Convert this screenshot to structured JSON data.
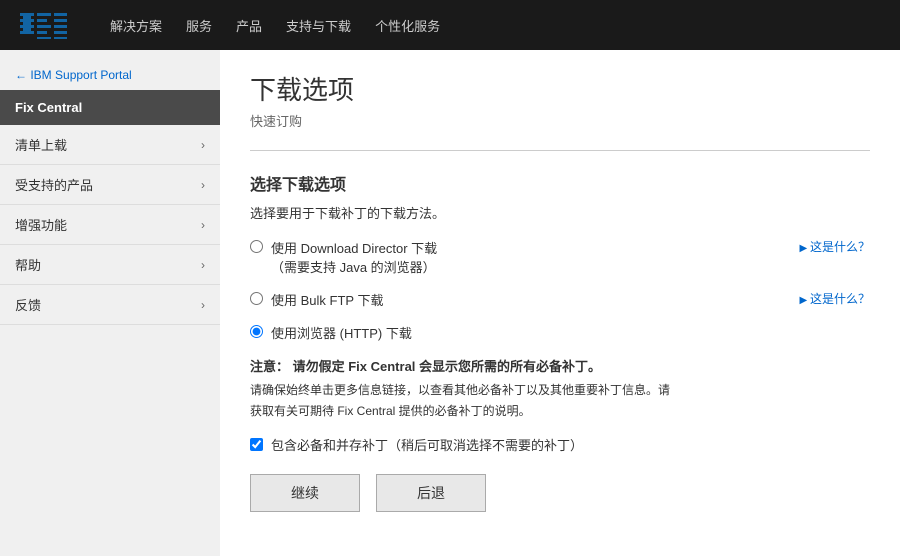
{
  "topnav": {
    "links": [
      "解决方案",
      "服务",
      "产品",
      "支持与下载",
      "个性化服务"
    ]
  },
  "sidebar": {
    "back_label": "IBM Support Portal",
    "title": "Fix Central",
    "items": [
      {
        "label": "清单上载"
      },
      {
        "label": "受支持的产品"
      },
      {
        "label": "增强功能"
      },
      {
        "label": "帮助"
      },
      {
        "label": "反馈"
      }
    ]
  },
  "content": {
    "page_title": "下载选项",
    "page_subtitle": "快速订购",
    "section_title": "选择下载选项",
    "section_desc": "选择要用于下载补丁的下载方法。",
    "options": [
      {
        "id": "opt1",
        "label_line1": "使用 Download Director 下载",
        "label_line2": "（需要支持 Java 的浏览器）",
        "link": "这是什么？",
        "checked": false
      },
      {
        "id": "opt2",
        "label_line1": "使用 Bulk FTP 下载",
        "label_line2": "",
        "link": "这是什么？",
        "checked": false
      },
      {
        "id": "opt3",
        "label_line1": "使用浏览器 (HTTP) 下载",
        "label_line2": "",
        "link": "",
        "checked": true
      }
    ],
    "note_bold": "注意：  请勿假定 Fix Central 会显示您所需的所有必备补丁。",
    "note_line1": "请确保始终单击更多信息链接，以查看其他必备补丁以及其他重要补丁信息。请",
    "note_line2": "获取有关可期待 Fix Central 提供的必备补丁的说明。",
    "checkbox_label": "包含必备和并存补丁（稍后可取消选择不需要的补丁）",
    "checkbox_checked": true,
    "btn_continue": "继续",
    "btn_back": "后退"
  }
}
